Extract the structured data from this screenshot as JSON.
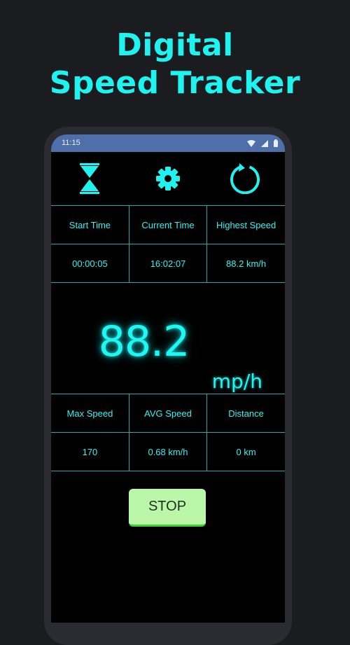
{
  "banner": {
    "line1": "Digital",
    "line2": "Speed Tracker"
  },
  "status_bar": {
    "time": "11:15"
  },
  "toolbar": {
    "icons": [
      "hourglass-icon",
      "gear-icon",
      "refresh-icon"
    ]
  },
  "time_table": {
    "headers": [
      "Start Time",
      "Current Time",
      "Highest Speed"
    ],
    "values": [
      "00:00:05",
      "16:02:07",
      "88.2 km/h"
    ]
  },
  "speedometer": {
    "value": "88.2",
    "unit": "mp/h"
  },
  "stats_table": {
    "headers": [
      "Max Speed",
      "AVG Speed",
      "Distance"
    ],
    "values": [
      "170",
      "0.68 km/h",
      "0 km"
    ]
  },
  "stop_button": {
    "label": "STOP"
  },
  "colors": {
    "accent": "#1ff3ef",
    "background": "#1b1c20",
    "button": "#bbf7a8"
  }
}
